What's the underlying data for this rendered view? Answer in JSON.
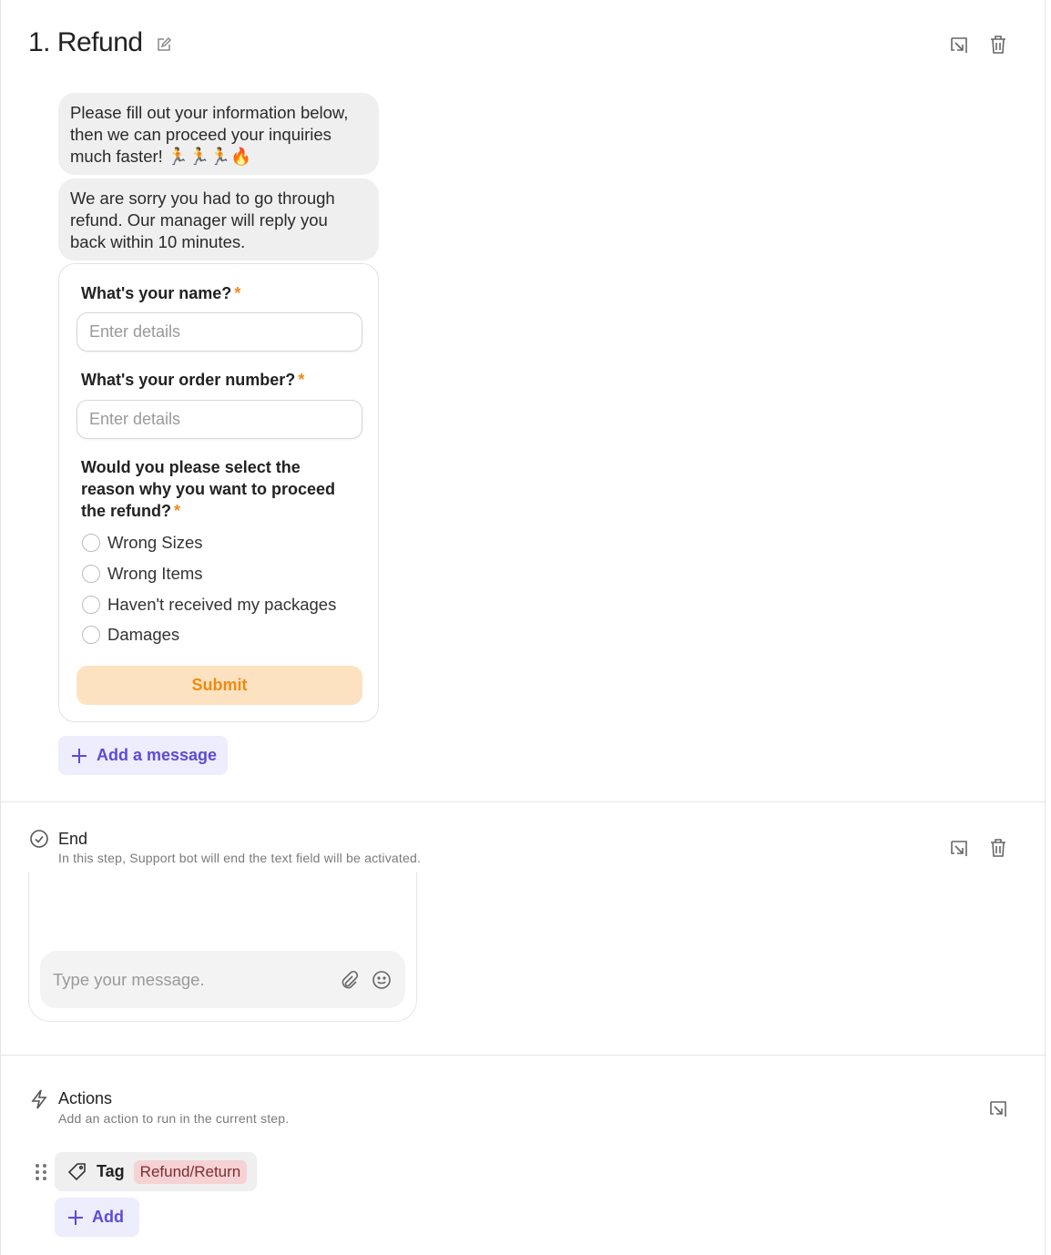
{
  "step": {
    "title": "1. Refund",
    "messages": [
      "Please fill out your information below, then we can proceed your inquiries much faster! 🏃🏃🏃🔥",
      "We are sorry you had to go through refund. Our manager will reply you back within 10 minutes."
    ],
    "form": {
      "name_label": "What's your name?",
      "name_placeholder": "Enter details",
      "order_label": "What's your order number?",
      "order_placeholder": "Enter details",
      "reason_label": "Would you please select the reason why you want to proceed the refund?",
      "required_mark": "*",
      "options": [
        "Wrong Sizes",
        "Wrong Items",
        "Haven't received my packages",
        "Damages"
      ],
      "submit_label": "Submit"
    },
    "add_message_label": "Add a message"
  },
  "end": {
    "title": "End",
    "description": "In this step, Support bot will end the text field will be activated.",
    "input_placeholder": "Type your message."
  },
  "actions": {
    "title": "Actions",
    "description": "Add an action to run in the current step.",
    "tag_label": "Tag",
    "tag_value": "Refund/Return",
    "add_label": "Add"
  },
  "colors": {
    "accent": "#5b4bd6",
    "submit_text": "#ef8a10",
    "submit_bg": "#fde2c2",
    "required": "#f08a1c",
    "tag_bg": "#f6d2d4"
  },
  "icons": [
    "edit-icon",
    "open-external-icon",
    "trash-icon",
    "check-circle-icon",
    "paperclip-icon",
    "smiley-icon",
    "lightning-icon",
    "tag-icon",
    "drag-handle-icon",
    "plus-icon"
  ]
}
